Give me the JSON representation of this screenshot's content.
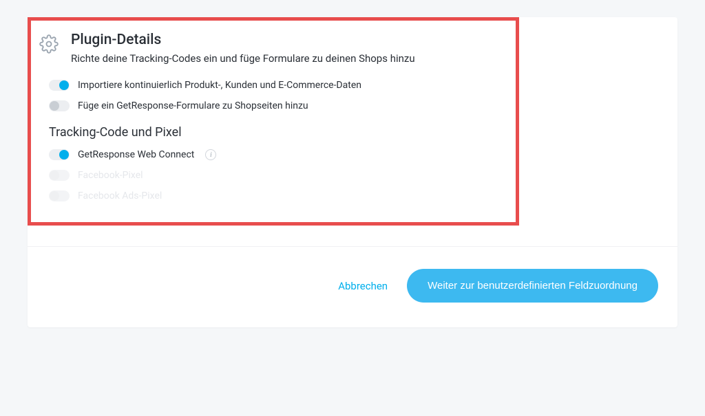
{
  "header": {
    "title": "Plugin-Details",
    "subtitle": "Richte deine Tracking-Codes ein und füge Formulare zu deinen Shops hinzu"
  },
  "toggles": {
    "import": {
      "label": "Importiere kontinuierlich Produkt-, Kunden und E-Commerce-Daten",
      "on": true
    },
    "forms": {
      "label": "Füge ein GetResponse-Formulare zu Shopseiten hinzu",
      "on": false
    }
  },
  "section_heading": "Tracking-Code und Pixel",
  "tracking": {
    "webconnect": {
      "label": "GetResponse Web Connect",
      "on": true
    },
    "fbpixel": {
      "label": "Facebook-Pixel",
      "on": false
    },
    "fbads": {
      "label": "Facebook Ads-Pixel",
      "on": false
    }
  },
  "footer": {
    "cancel": "Abbrechen",
    "continue": "Weiter zur benutzerdefinierten Feldzuordnung"
  }
}
